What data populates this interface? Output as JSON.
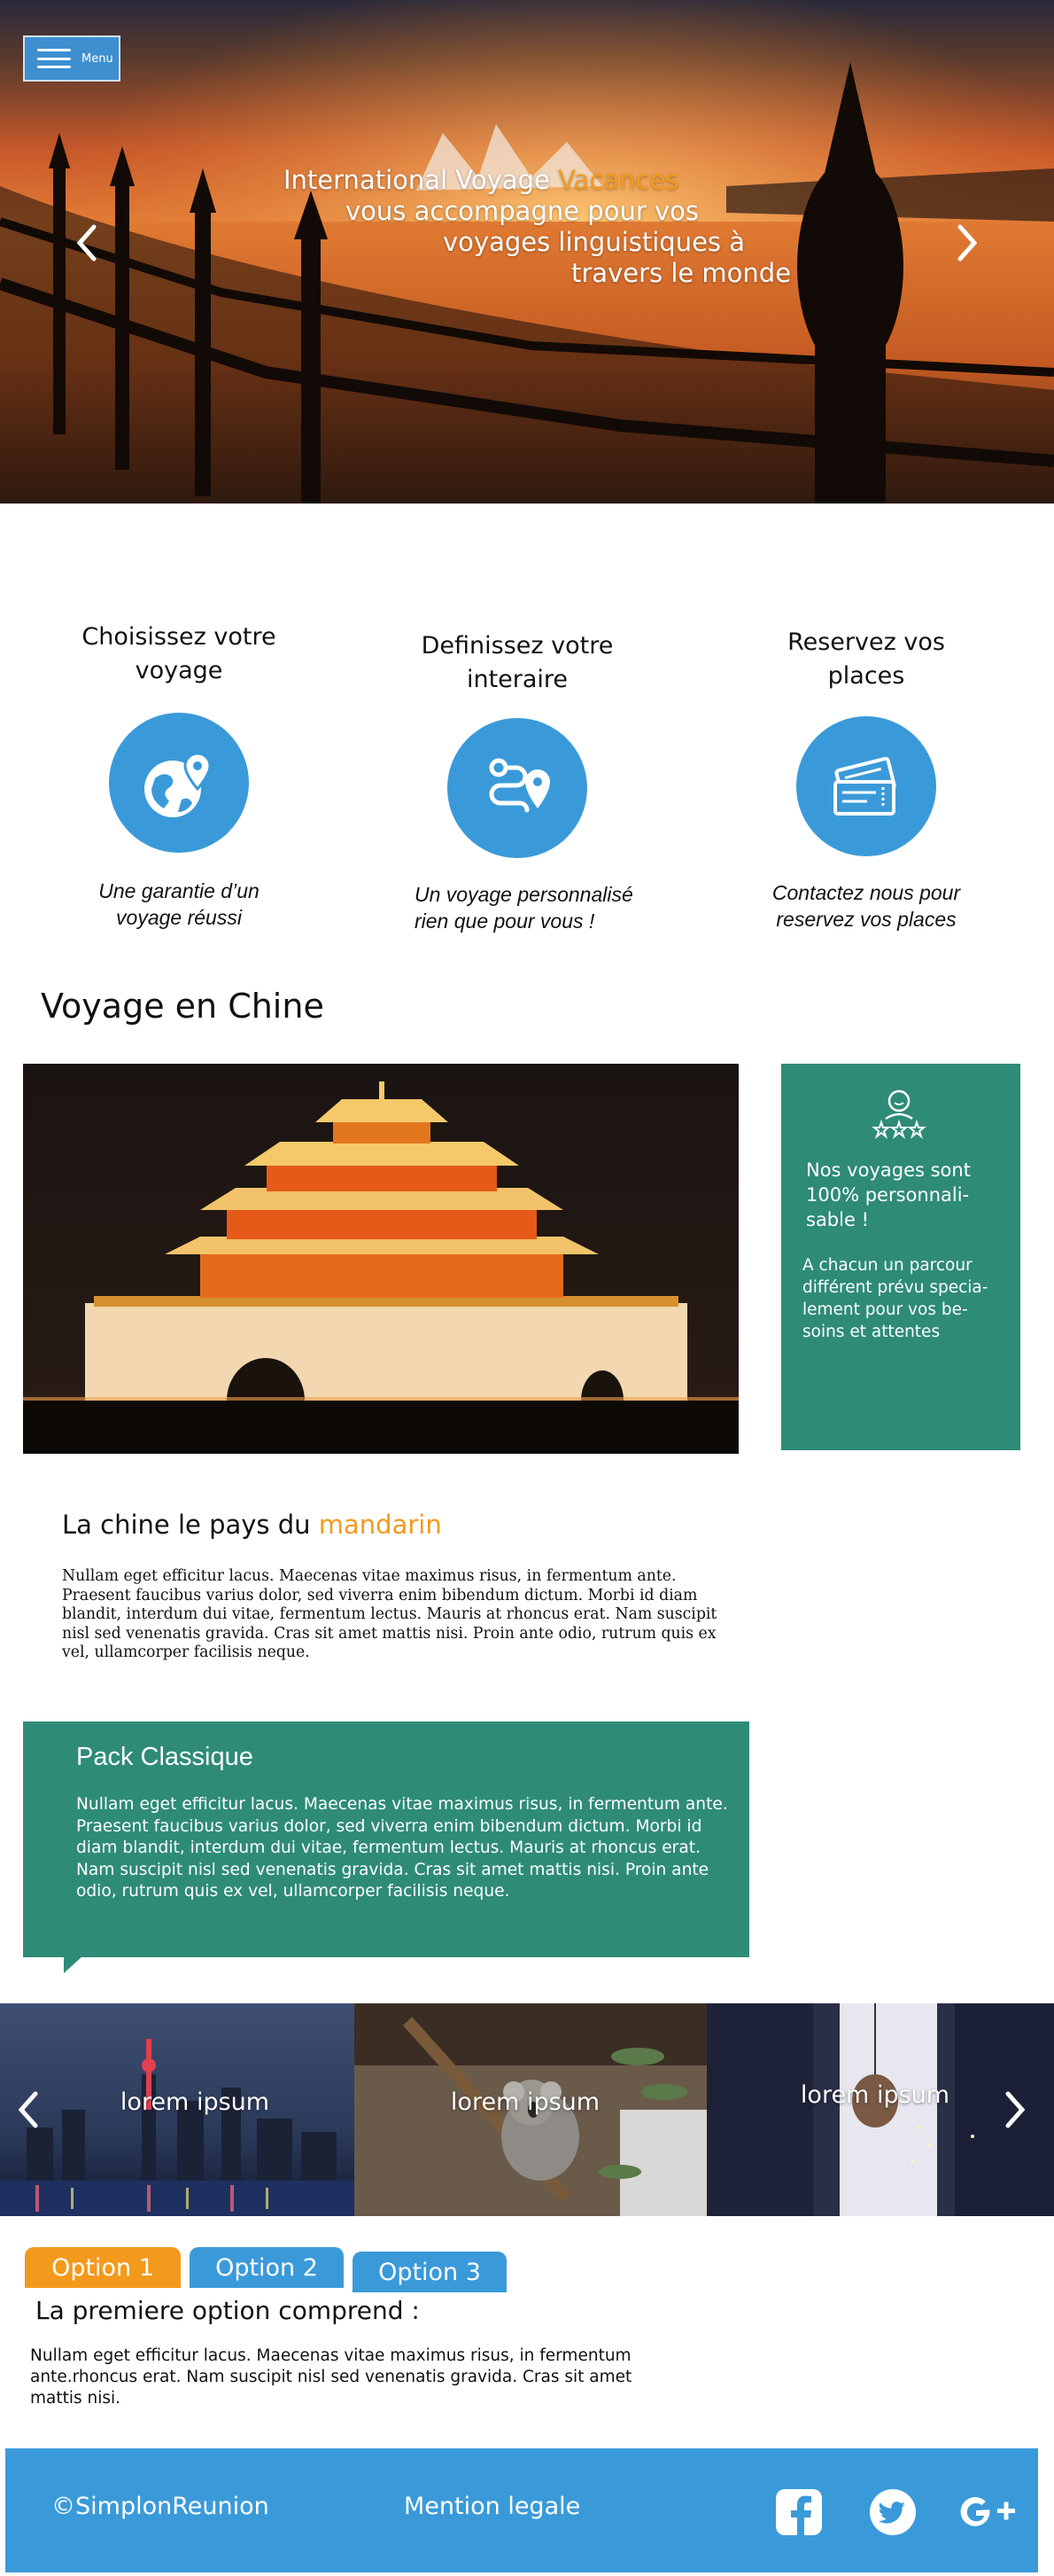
{
  "hero": {
    "menu_label": "Menu",
    "line1_prefix": "International Voyage ",
    "line1_accent": "Vacances",
    "line2": "vous accompagne pour vos",
    "line3": "voyages linguistiques à",
    "line4": "travers le monde",
    "prev_icon": "chevron-left-icon",
    "next_icon": "chevron-right-icon"
  },
  "steps": [
    {
      "title": "Choisissez votre\nvoyage",
      "icon": "globe-location-icon",
      "desc": "Une garantie d’un\nvoyage réussi"
    },
    {
      "title": "Definissez votre\ninteraire",
      "icon": "route-pin-icon",
      "desc": "Un voyage personnalisé\nrien que pour vous !"
    },
    {
      "title": "Reservez vos\nplaces",
      "icon": "tickets-icon",
      "desc": "Contactez nous pour\nreservez vos places"
    }
  ],
  "section": {
    "title": "Voyage en Chine"
  },
  "green_card": {
    "icon": "user-rating-icon",
    "title": "Nos voyages sont\n100% personnali-\nsable !",
    "text": "A chacun un parcour\ndifférent prévu specia-\nlement pour vos be-\nsoins et attentes"
  },
  "china": {
    "heading_prefix": "La chine le pays du ",
    "heading_accent": "mandarin",
    "body": "Nullam eget efficitur lacus. Maecenas vitae maximus risus, in fermentum ante. Praesent faucibus varius dolor, sed viverra enim bibendum dictum. Morbi id diam blandit, interdum dui vitae, fermentum lectus. Mauris at rhoncus erat. Nam suscipit nisl sed venenatis gravida. Cras sit amet mattis nisi. Proin ante odio, rutrum quis ex vel, ullamcorper facilisis neque."
  },
  "pack": {
    "title": "Pack Classique",
    "body": "Nullam eget efficitur lacus. Maecenas vitae maximus risus, in fermentum ante. Praesent faucibus varius dolor, sed viverra enim bibendum dictum. Morbi id diam blandit, interdum dui vitae, fermentum lectus. Mauris at rhoncus erat. Nam suscipit nisl sed venenatis gravida. Cras sit amet mattis nisi. Proin ante odio, rutrum quis ex vel, ullamcorper facilisis neque."
  },
  "carousel": {
    "slides": [
      {
        "label": "lorem ipsum"
      },
      {
        "label": "lorem ipsum"
      },
      {
        "label": "lorem ipsum"
      }
    ]
  },
  "tabs": {
    "items": [
      {
        "label": "Option 1",
        "color": "#f39a1c",
        "active": true
      },
      {
        "label": "Option 2",
        "color": "#3a9ad9",
        "active": false
      },
      {
        "label": "Option 3",
        "color": "#3a9ad9",
        "active": false
      }
    ],
    "heading": "La premiere option comprend :",
    "body": "Nullam eget efficitur lacus. Maecenas vitae maximus risus, in fermentum ante.rhoncus erat. Nam suscipit nisl sed venenatis gravida. Cras sit amet mattis nisi."
  },
  "footer": {
    "copyright": "©SimplonReunion",
    "legal": "Mention legale",
    "social": [
      "facebook-icon",
      "twitter-icon",
      "google-plus-icon"
    ]
  },
  "colors": {
    "accent": "#f39a1c",
    "blue": "#3a9ad9",
    "green": "#2e8b77"
  }
}
